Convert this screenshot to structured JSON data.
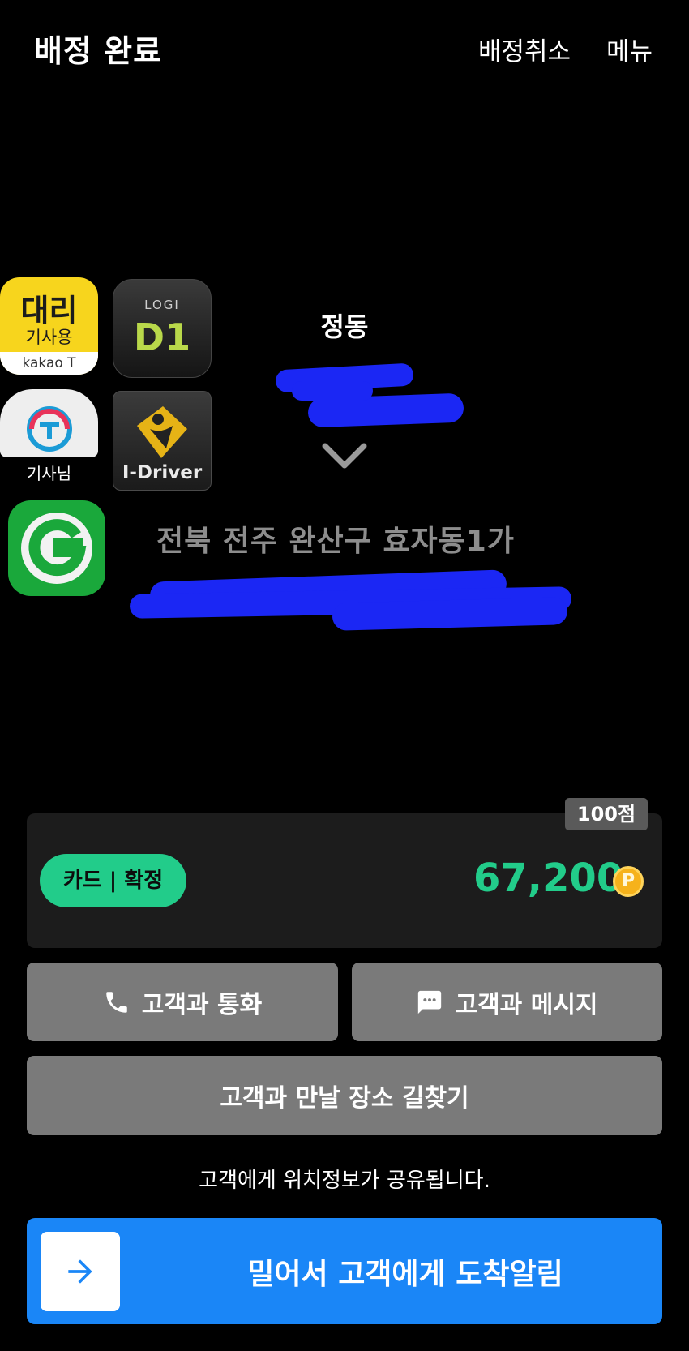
{
  "header": {
    "title": "배정 완료",
    "cancel_label": "배정취소",
    "menu_label": "메뉴"
  },
  "apps": {
    "kakao": {
      "big": "대리",
      "sub": "기사용",
      "foot": "kakao T"
    },
    "logi_d1": {
      "top": "LOGI",
      "main": "D1"
    },
    "tmap": {
      "label": "기사님"
    },
    "idriver": {
      "label": "I-Driver"
    }
  },
  "route": {
    "origin_name": "정동",
    "destination_address": "전북 전주 완산구 효자동1가"
  },
  "fare": {
    "score_badge": "100점",
    "payment_label": "카드 | 확정",
    "amount": "67,200",
    "coin_symbol": "P"
  },
  "actions": {
    "call_label": "고객과 통화",
    "message_label": "고객과 메시지",
    "navigate_label": "고객과 만날 장소 길찾기"
  },
  "notice": "고객에게 위치정보가 공유됩니다.",
  "slider": {
    "label": "밀어서 고객에게 도착알림"
  },
  "colors": {
    "accent_green": "#22cc8a",
    "accent_blue": "#1a86f7",
    "redaction_blue": "#1b27f4",
    "button_gray": "#7a7a7a",
    "card_bg": "#1c1c1c"
  }
}
